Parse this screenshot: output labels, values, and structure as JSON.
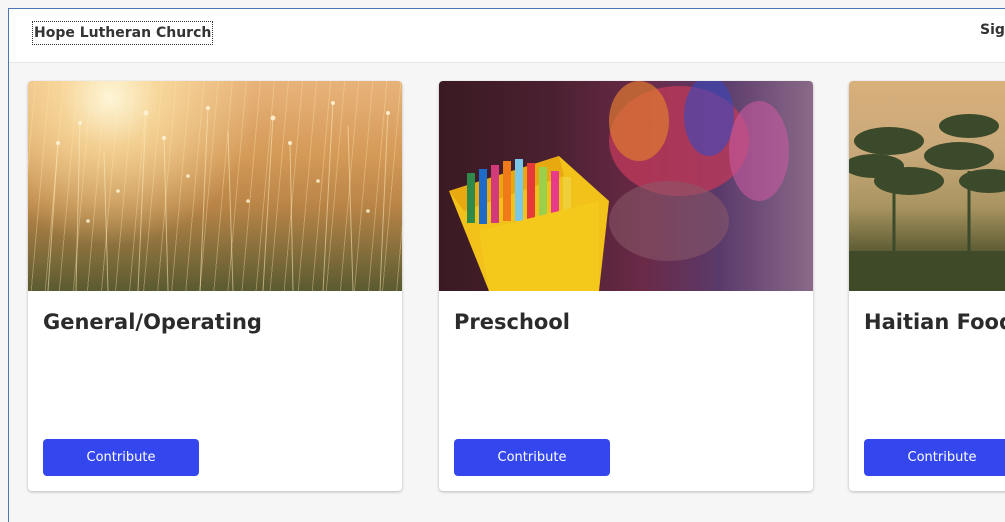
{
  "header": {
    "brand": "Hope Lutheran Church",
    "signin": "Sign In"
  },
  "cards": [
    {
      "title": "General/Operating",
      "button": "Contribute",
      "image": "golden-grass-field-photo"
    },
    {
      "title": "Preschool",
      "button": "Contribute",
      "image": "crayon-box-photo"
    },
    {
      "title": "Haitian Food",
      "button": "Contribute",
      "image": "trees-at-sunset-photo"
    }
  ],
  "colors": {
    "accent": "#3447ee",
    "page_bg": "#f6f6f6",
    "frame_border": "#4a78b5"
  }
}
